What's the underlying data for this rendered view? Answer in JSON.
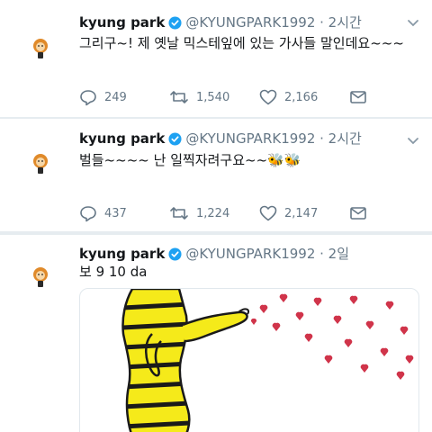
{
  "tweets": [
    {
      "name": "kyung park",
      "handle": "@KYUNGPARK1992 · 2시간",
      "text": "그리구~! 제 옛날 믹스테잎에 있는 가사들 말인데요~~~",
      "replies": "249",
      "retweets": "1,540",
      "likes": "2,166"
    },
    {
      "name": "kyung park",
      "handle": "@KYUNGPARK1992 · 2시간",
      "text": "벌들~~~~ 난 일찍자려구요~~🐝🐝",
      "replies": "437",
      "retweets": "1,224",
      "likes": "2,147"
    },
    {
      "name": "kyung park",
      "handle": "@KYUNGPARK1992 · 2일",
      "text": "보 9 10 da"
    }
  ],
  "icons": {
    "avatar": "avatar-icon",
    "verified": "verified-badge-icon",
    "caret": "chevron-down-icon",
    "reply": "reply-icon",
    "retweet": "retweet-icon",
    "like": "heart-icon",
    "dm": "envelope-icon"
  },
  "colors": {
    "verified": "#1da1f2",
    "secondary_text": "#657786",
    "divider": "#e6ecf0",
    "illustration_yellow": "#f5ea1a",
    "illustration_hearts": "#d0344a"
  }
}
